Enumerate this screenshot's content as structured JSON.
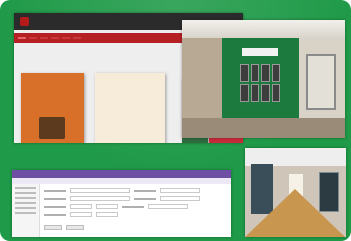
{
  "colors": {
    "frame_green": "#1f9a48",
    "site_red": "#b52025",
    "webapp_purple": "#6f4fa3"
  },
  "website": {
    "logo_text": "",
    "nav_links": [
      "",
      "",
      ""
    ],
    "menu_items": [
      "",
      "",
      "",
      "",
      "",
      ""
    ],
    "active_menu_index": 0
  },
  "books": [
    {
      "title": ""
    },
    {
      "title": ""
    },
    {
      "title": ""
    },
    {
      "title": ""
    }
  ],
  "webapp": {
    "title": ""
  }
}
